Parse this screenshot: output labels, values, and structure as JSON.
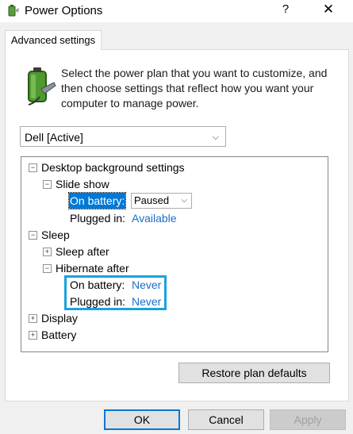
{
  "window": {
    "title": "Power Options",
    "help_glyph": "?",
    "close_glyph": "✕"
  },
  "tab": {
    "label": "Advanced settings"
  },
  "description": "Select the power plan that you want to customize, and then choose settings that reflect how you want your computer to manage power.",
  "plan_select": {
    "value": "Dell [Active]"
  },
  "tree": {
    "desktop_background": {
      "label": "Desktop background settings",
      "expander": "−"
    },
    "slide_show": {
      "label": "Slide show",
      "expander": "−"
    },
    "slide_show_on_battery": {
      "label": "On battery:",
      "value": "Paused"
    },
    "slide_show_plugged_in": {
      "label": "Plugged in:",
      "value": "Available"
    },
    "sleep": {
      "label": "Sleep",
      "expander": "−"
    },
    "sleep_after": {
      "label": "Sleep after",
      "expander": "+"
    },
    "hibernate_after": {
      "label": "Hibernate after",
      "expander": "−"
    },
    "hibernate_on_battery": {
      "label": "On battery:",
      "value": "Never"
    },
    "hibernate_plugged_in": {
      "label": "Plugged in:",
      "value": "Never"
    },
    "display": {
      "label": "Display",
      "expander": "+"
    },
    "battery": {
      "label": "Battery",
      "expander": "+"
    }
  },
  "buttons": {
    "restore": "Restore plan defaults",
    "ok": "OK",
    "cancel": "Cancel",
    "apply": "Apply"
  },
  "colors": {
    "accent": "#0078d7",
    "link_value": "#1a6fc9",
    "highlight_border": "#19a3dc"
  }
}
